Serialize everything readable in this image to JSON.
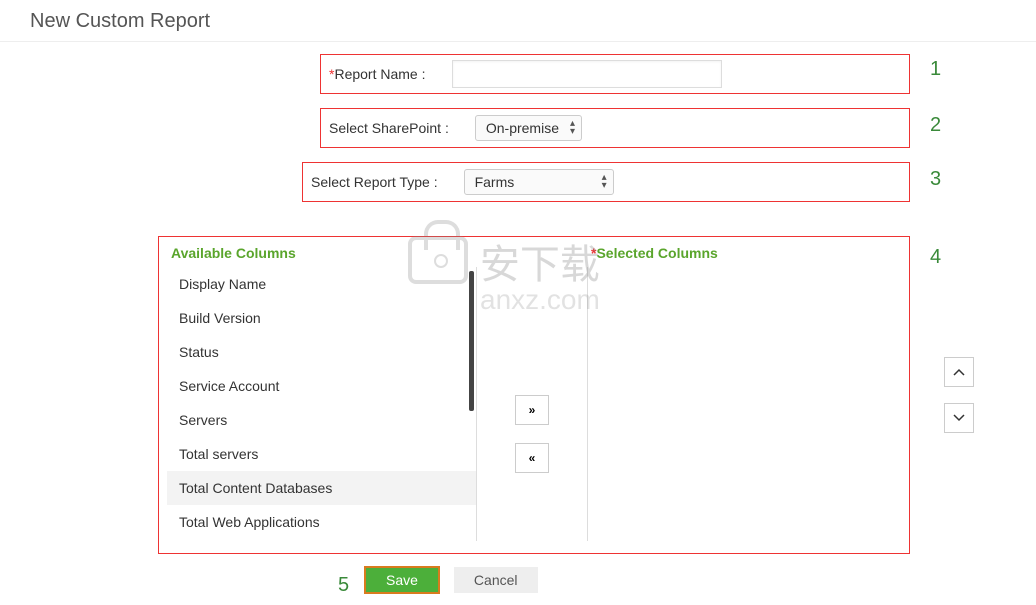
{
  "page_title": "New Custom Report",
  "fields": {
    "report_name_label": "Report Name :",
    "report_name_value": "",
    "sharepoint_label": "Select SharePoint :",
    "sharepoint_value": "On-premise",
    "report_type_label": "Select Report Type :",
    "report_type_value": "Farms"
  },
  "annotations": {
    "n1": "1",
    "n2": "2",
    "n3": "3",
    "n4": "4",
    "n5": "5"
  },
  "columns": {
    "available_header": "Available Columns",
    "selected_header": "Selected Columns",
    "available": [
      "Display Name",
      "Build Version",
      "Status",
      "Service Account",
      "Servers",
      "Total servers",
      "Total Content Databases",
      "Total Web Applications"
    ],
    "selected": []
  },
  "buttons": {
    "save": "Save",
    "cancel": "Cancel",
    "move_right": "»",
    "move_left": "«",
    "move_up": "⌃",
    "move_down": "⌄"
  },
  "watermark": {
    "line1": "安下载",
    "line2": "anxz.com"
  }
}
